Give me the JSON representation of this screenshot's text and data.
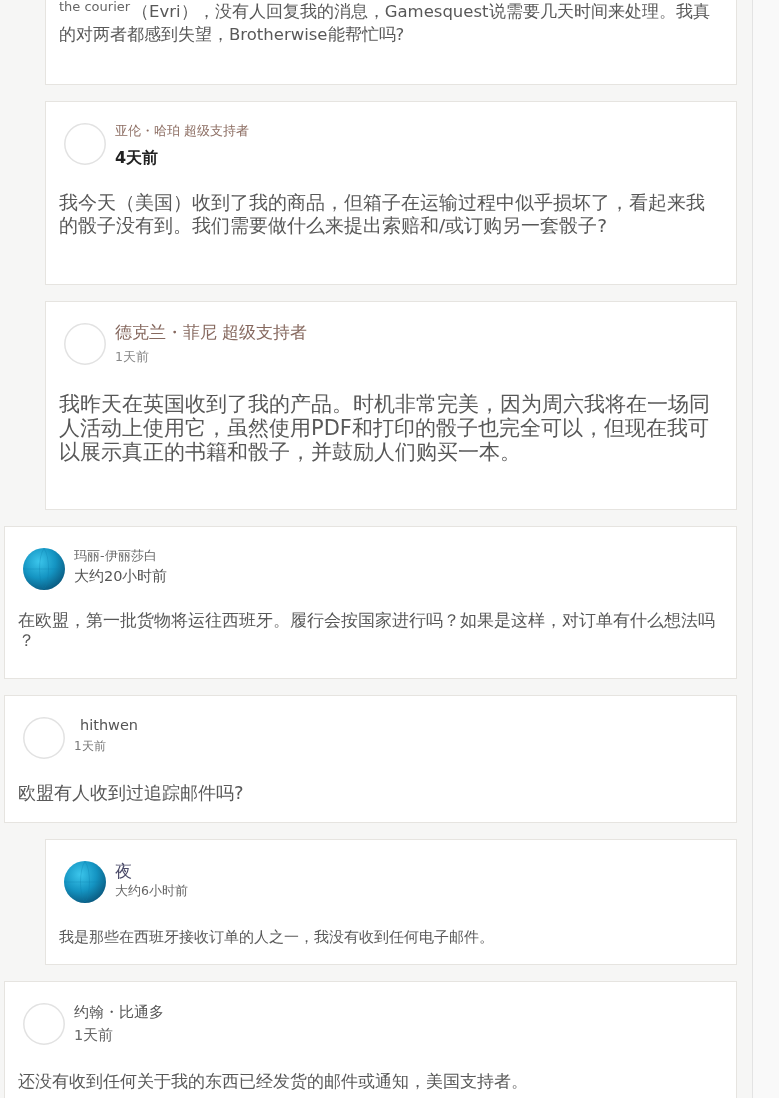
{
  "replies_continued": [
    {
      "body": "$^{the courier}$（Evri），没有人回复我的消息，Gamesquest说需要几天时间来处理。我真的对两者都感到失望，Brotherwise能帮忙吗?"
    },
    {
      "author": "亚伦・哈珀",
      "badge": "超级支持者",
      "time": "4天前",
      "has_avatar": false,
      "body": "我今天（美国）收到了我的商品，但箱子在运输过程中似乎损坏了，看起来我的骰子没有到。我们需要做什么来提出索赔和/或订购另一套骰子?"
    },
    {
      "author": "德克兰・菲尼",
      "badge": "超级支持者",
      "time": "1天前",
      "has_avatar": false,
      "body": "我昨天在英国收到了我的产品。时机非常完美，因为周六我将在一场同人活动上使用它，虽然使用PDF和打印的骰子也完全可以，但现在我可以展示真正的书籍和骰子，并鼓励人们购买一本。"
    }
  ],
  "comments": [
    {
      "author": "玛丽-伊丽莎白",
      "time": "大约20小时前",
      "has_avatar": true,
      "body": "在欧盟，第一批货物将运往西班牙。履行会按国家进行吗？如果是这样，对订单有什么想法吗？"
    },
    {
      "author": "hithwen",
      "time": "1天前",
      "has_avatar": false,
      "body": "欧盟有人收到过追踪邮件吗?",
      "children": [
        {
          "author": "夜",
          "time": "大约6小时前",
          "has_avatar": true,
          "body": "我是那些在西班牙接收订单的人之一，我没有收到任何电子邮件。"
        }
      ]
    },
    {
      "author": "约翰・比通多",
      "time": "1天前",
      "has_avatar": false,
      "body": "还没有收到任何关于我的东西已经发货的邮件或通知，美国支持者。"
    }
  ]
}
